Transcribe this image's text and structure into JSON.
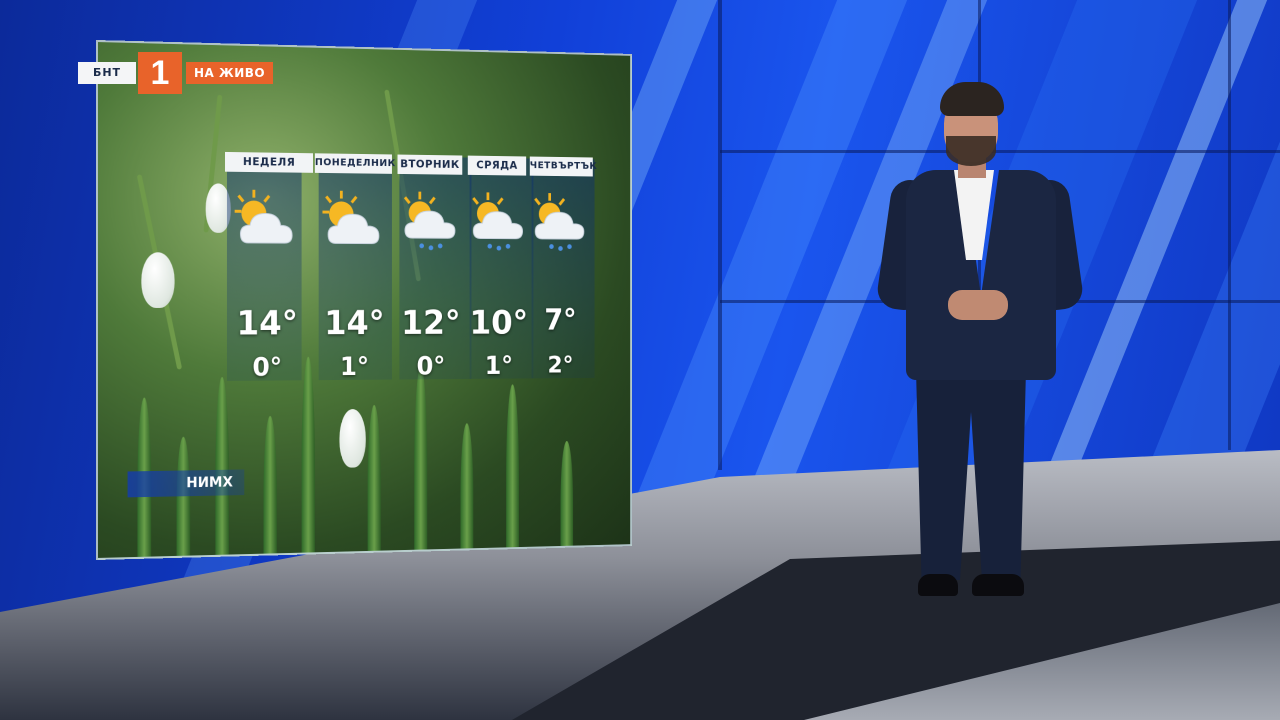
{
  "channel": {
    "name_strip": "БНТ",
    "number": "1",
    "live_label": "НА ЖИВО",
    "accent_color": "#e8632a"
  },
  "forecast": {
    "source": "НИМХ",
    "days": [
      {
        "label": "НЕДЕЛЯ",
        "icon": "sun-behind-cloud-icon",
        "high": "14°",
        "low": "0°"
      },
      {
        "label": "ПОНЕДЕЛНИК",
        "icon": "sun-behind-cloud-icon",
        "high": "14°",
        "low": "1°"
      },
      {
        "label": "ВТОРНИК",
        "icon": "sun-cloud-rain-icon",
        "high": "12°",
        "low": "0°"
      },
      {
        "label": "СРЯДА",
        "icon": "sun-cloud-rain-icon",
        "high": "10°",
        "low": "1°"
      },
      {
        "label": "ЧЕТВЪРТЪК",
        "icon": "sun-cloud-rain-icon",
        "high": "7°",
        "low": "2°"
      }
    ]
  }
}
